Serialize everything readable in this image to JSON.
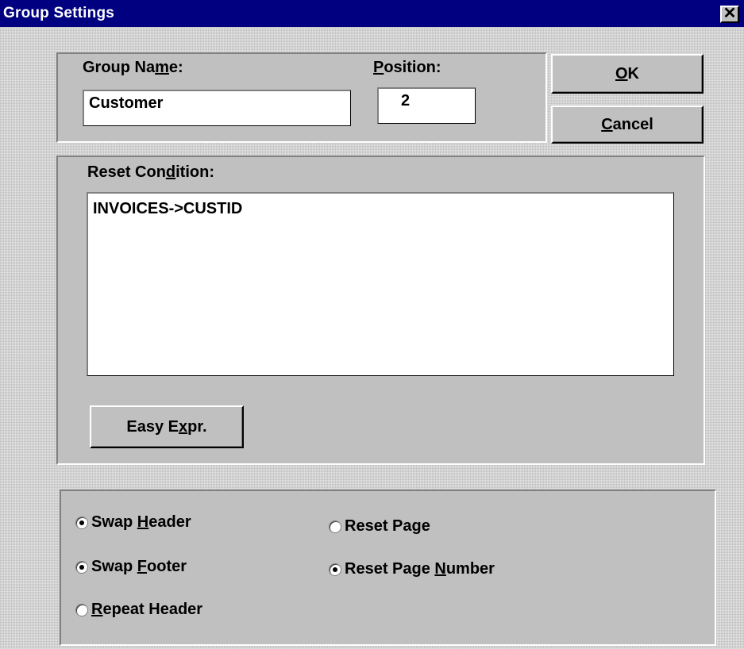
{
  "window": {
    "title": "Group Settings",
    "close_glyph": "✕"
  },
  "group_name": {
    "label_pre": "Group Na",
    "label_key": "m",
    "label_post": "e:",
    "value": "Customer"
  },
  "position": {
    "label_pre": "",
    "label_key": "P",
    "label_post": "osition:",
    "value": "2"
  },
  "buttons": {
    "ok": {
      "pre": "",
      "key": "O",
      "post": "K"
    },
    "cancel": {
      "pre": "",
      "key": "C",
      "post": "ancel"
    },
    "easy_expr": {
      "pre": "Easy E",
      "key": "x",
      "post": "pr."
    }
  },
  "reset_condition": {
    "label_pre": "Reset Con",
    "label_key": "d",
    "label_post": "ition:",
    "value": "INVOICES->CUSTID"
  },
  "options": {
    "swap_header": {
      "pre": "Swap ",
      "key": "H",
      "post": "eader",
      "checked": true
    },
    "swap_footer": {
      "pre": "Swap ",
      "key": "F",
      "post": "ooter",
      "checked": true
    },
    "repeat_header": {
      "pre": "",
      "key": "R",
      "post": "epeat Header",
      "checked": false
    },
    "reset_page": {
      "pre": "Reset Page",
      "key": "",
      "post": "",
      "checked": false
    },
    "reset_page_number": {
      "pre": "Reset Page ",
      "key": "N",
      "post": "umber",
      "checked": true
    }
  }
}
